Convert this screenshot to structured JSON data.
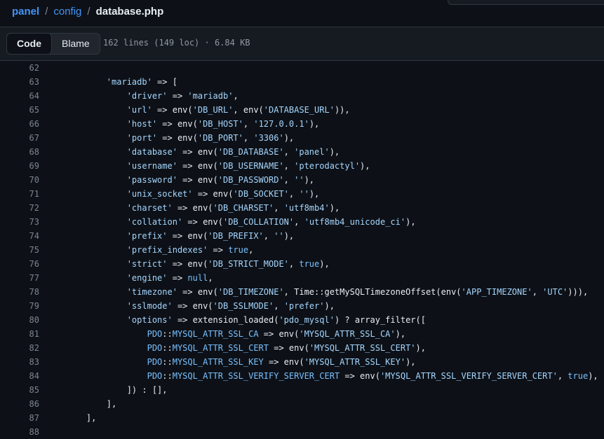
{
  "breadcrumb": {
    "repo": "panel",
    "folder": "config",
    "file": "database.php",
    "separator": "/"
  },
  "toolbar": {
    "code_label": "Code",
    "blame_label": "Blame",
    "file_info": "162 lines (149 loc) · 6.84 KB"
  },
  "colors": {
    "string": "#a5d6ff",
    "constant": "#79c0ff",
    "function": "#d2a8ff",
    "link": "#4493f8",
    "background": "#0d1117"
  },
  "code_lines": [
    {
      "n": "62",
      "tokens": [
        {
          "t": "",
          "c": "p"
        }
      ]
    },
    {
      "n": "63",
      "tokens": [
        {
          "t": "        ",
          "c": "p"
        },
        {
          "t": "'mariadb'",
          "c": "s"
        },
        {
          "t": " => [",
          "c": "p"
        }
      ]
    },
    {
      "n": "64",
      "tokens": [
        {
          "t": "            ",
          "c": "p"
        },
        {
          "t": "'driver'",
          "c": "s"
        },
        {
          "t": " => ",
          "c": "p"
        },
        {
          "t": "'mariadb'",
          "c": "s"
        },
        {
          "t": ",",
          "c": "p"
        }
      ]
    },
    {
      "n": "65",
      "tokens": [
        {
          "t": "            ",
          "c": "p"
        },
        {
          "t": "'url'",
          "c": "s"
        },
        {
          "t": " => env(",
          "c": "p"
        },
        {
          "t": "'DB_URL'",
          "c": "s"
        },
        {
          "t": ", env(",
          "c": "p"
        },
        {
          "t": "'DATABASE_URL'",
          "c": "s"
        },
        {
          "t": ")),",
          "c": "p"
        }
      ]
    },
    {
      "n": "66",
      "tokens": [
        {
          "t": "            ",
          "c": "p"
        },
        {
          "t": "'host'",
          "c": "s"
        },
        {
          "t": " => env(",
          "c": "p"
        },
        {
          "t": "'DB_HOST'",
          "c": "s"
        },
        {
          "t": ", ",
          "c": "p"
        },
        {
          "t": "'127.0.0.1'",
          "c": "s"
        },
        {
          "t": "),",
          "c": "p"
        }
      ]
    },
    {
      "n": "67",
      "tokens": [
        {
          "t": "            ",
          "c": "p"
        },
        {
          "t": "'port'",
          "c": "s"
        },
        {
          "t": " => env(",
          "c": "p"
        },
        {
          "t": "'DB_PORT'",
          "c": "s"
        },
        {
          "t": ", ",
          "c": "p"
        },
        {
          "t": "'3306'",
          "c": "s"
        },
        {
          "t": "),",
          "c": "p"
        }
      ]
    },
    {
      "n": "68",
      "tokens": [
        {
          "t": "            ",
          "c": "p"
        },
        {
          "t": "'database'",
          "c": "s"
        },
        {
          "t": " => env(",
          "c": "p"
        },
        {
          "t": "'DB_DATABASE'",
          "c": "s"
        },
        {
          "t": ", ",
          "c": "p"
        },
        {
          "t": "'panel'",
          "c": "s"
        },
        {
          "t": "),",
          "c": "p"
        }
      ]
    },
    {
      "n": "69",
      "tokens": [
        {
          "t": "            ",
          "c": "p"
        },
        {
          "t": "'username'",
          "c": "s"
        },
        {
          "t": " => env(",
          "c": "p"
        },
        {
          "t": "'DB_USERNAME'",
          "c": "s"
        },
        {
          "t": ", ",
          "c": "p"
        },
        {
          "t": "'pterodactyl'",
          "c": "s"
        },
        {
          "t": "),",
          "c": "p"
        }
      ]
    },
    {
      "n": "70",
      "tokens": [
        {
          "t": "            ",
          "c": "p"
        },
        {
          "t": "'password'",
          "c": "s"
        },
        {
          "t": " => env(",
          "c": "p"
        },
        {
          "t": "'DB_PASSWORD'",
          "c": "s"
        },
        {
          "t": ", ",
          "c": "p"
        },
        {
          "t": "''",
          "c": "s"
        },
        {
          "t": "),",
          "c": "p"
        }
      ]
    },
    {
      "n": "71",
      "tokens": [
        {
          "t": "            ",
          "c": "p"
        },
        {
          "t": "'unix_socket'",
          "c": "s"
        },
        {
          "t": " => env(",
          "c": "p"
        },
        {
          "t": "'DB_SOCKET'",
          "c": "s"
        },
        {
          "t": ", ",
          "c": "p"
        },
        {
          "t": "''",
          "c": "s"
        },
        {
          "t": "),",
          "c": "p"
        }
      ]
    },
    {
      "n": "72",
      "tokens": [
        {
          "t": "            ",
          "c": "p"
        },
        {
          "t": "'charset'",
          "c": "s"
        },
        {
          "t": " => env(",
          "c": "p"
        },
        {
          "t": "'DB_CHARSET'",
          "c": "s"
        },
        {
          "t": ", ",
          "c": "p"
        },
        {
          "t": "'utf8mb4'",
          "c": "s"
        },
        {
          "t": "),",
          "c": "p"
        }
      ]
    },
    {
      "n": "73",
      "tokens": [
        {
          "t": "            ",
          "c": "p"
        },
        {
          "t": "'collation'",
          "c": "s"
        },
        {
          "t": " => env(",
          "c": "p"
        },
        {
          "t": "'DB_COLLATION'",
          "c": "s"
        },
        {
          "t": ", ",
          "c": "p"
        },
        {
          "t": "'utf8mb4_unicode_ci'",
          "c": "s"
        },
        {
          "t": "),",
          "c": "p"
        }
      ]
    },
    {
      "n": "74",
      "tokens": [
        {
          "t": "            ",
          "c": "p"
        },
        {
          "t": "'prefix'",
          "c": "s"
        },
        {
          "t": " => env(",
          "c": "p"
        },
        {
          "t": "'DB_PREFIX'",
          "c": "s"
        },
        {
          "t": ", ",
          "c": "p"
        },
        {
          "t": "''",
          "c": "s"
        },
        {
          "t": "),",
          "c": "p"
        }
      ]
    },
    {
      "n": "75",
      "tokens": [
        {
          "t": "            ",
          "c": "p"
        },
        {
          "t": "'prefix_indexes'",
          "c": "s"
        },
        {
          "t": " => ",
          "c": "p"
        },
        {
          "t": "true",
          "c": "k"
        },
        {
          "t": ",",
          "c": "p"
        }
      ]
    },
    {
      "n": "76",
      "tokens": [
        {
          "t": "            ",
          "c": "p"
        },
        {
          "t": "'strict'",
          "c": "s"
        },
        {
          "t": " => env(",
          "c": "p"
        },
        {
          "t": "'DB_STRICT_MODE'",
          "c": "s"
        },
        {
          "t": ", ",
          "c": "p"
        },
        {
          "t": "true",
          "c": "k"
        },
        {
          "t": "),",
          "c": "p"
        }
      ]
    },
    {
      "n": "77",
      "tokens": [
        {
          "t": "            ",
          "c": "p"
        },
        {
          "t": "'engine'",
          "c": "s"
        },
        {
          "t": " => ",
          "c": "p"
        },
        {
          "t": "null",
          "c": "k"
        },
        {
          "t": ",",
          "c": "p"
        }
      ]
    },
    {
      "n": "78",
      "tokens": [
        {
          "t": "            ",
          "c": "p"
        },
        {
          "t": "'timezone'",
          "c": "s"
        },
        {
          "t": " => env(",
          "c": "p"
        },
        {
          "t": "'DB_TIMEZONE'",
          "c": "s"
        },
        {
          "t": ", Time::getMySQLTimezoneOffset(env(",
          "c": "p"
        },
        {
          "t": "'APP_TIMEZONE'",
          "c": "s"
        },
        {
          "t": ", ",
          "c": "p"
        },
        {
          "t": "'UTC'",
          "c": "s"
        },
        {
          "t": "))),",
          "c": "p"
        }
      ]
    },
    {
      "n": "79",
      "tokens": [
        {
          "t": "            ",
          "c": "p"
        },
        {
          "t": "'sslmode'",
          "c": "s"
        },
        {
          "t": " => env(",
          "c": "p"
        },
        {
          "t": "'DB_SSLMODE'",
          "c": "s"
        },
        {
          "t": ", ",
          "c": "p"
        },
        {
          "t": "'prefer'",
          "c": "s"
        },
        {
          "t": "),",
          "c": "p"
        }
      ]
    },
    {
      "n": "80",
      "tokens": [
        {
          "t": "            ",
          "c": "p"
        },
        {
          "t": "'options'",
          "c": "s"
        },
        {
          "t": " => extension_loaded(",
          "c": "p"
        },
        {
          "t": "'pdo_mysql'",
          "c": "s"
        },
        {
          "t": ") ? array_filter([",
          "c": "p"
        }
      ]
    },
    {
      "n": "81",
      "tokens": [
        {
          "t": "                ",
          "c": "p"
        },
        {
          "t": "PDO",
          "c": "k"
        },
        {
          "t": "::",
          "c": "p"
        },
        {
          "t": "MYSQL_ATTR_SSL_CA",
          "c": "k"
        },
        {
          "t": " => env(",
          "c": "p"
        },
        {
          "t": "'MYSQL_ATTR_SSL_CA'",
          "c": "s"
        },
        {
          "t": "),",
          "c": "p"
        }
      ]
    },
    {
      "n": "82",
      "tokens": [
        {
          "t": "                ",
          "c": "p"
        },
        {
          "t": "PDO",
          "c": "k"
        },
        {
          "t": "::",
          "c": "p"
        },
        {
          "t": "MYSQL_ATTR_SSL_CERT",
          "c": "k"
        },
        {
          "t": " => env(",
          "c": "p"
        },
        {
          "t": "'MYSQL_ATTR_SSL_CERT'",
          "c": "s"
        },
        {
          "t": "),",
          "c": "p"
        }
      ]
    },
    {
      "n": "83",
      "tokens": [
        {
          "t": "                ",
          "c": "p"
        },
        {
          "t": "PDO",
          "c": "k"
        },
        {
          "t": "::",
          "c": "p"
        },
        {
          "t": "MYSQL_ATTR_SSL_KEY",
          "c": "k"
        },
        {
          "t": " => env(",
          "c": "p"
        },
        {
          "t": "'MYSQL_ATTR_SSL_KEY'",
          "c": "s"
        },
        {
          "t": "),",
          "c": "p"
        }
      ]
    },
    {
      "n": "84",
      "tokens": [
        {
          "t": "                ",
          "c": "p"
        },
        {
          "t": "PDO",
          "c": "k"
        },
        {
          "t": "::",
          "c": "p"
        },
        {
          "t": "MYSQL_ATTR_SSL_VERIFY_SERVER_CERT",
          "c": "k"
        },
        {
          "t": " => env(",
          "c": "p"
        },
        {
          "t": "'MYSQL_ATTR_SSL_VERIFY_SERVER_CERT'",
          "c": "s"
        },
        {
          "t": ", ",
          "c": "p"
        },
        {
          "t": "true",
          "c": "k"
        },
        {
          "t": "),",
          "c": "p"
        }
      ]
    },
    {
      "n": "85",
      "tokens": [
        {
          "t": "            ]) : [],",
          "c": "p"
        }
      ]
    },
    {
      "n": "86",
      "tokens": [
        {
          "t": "        ],",
          "c": "p"
        }
      ]
    },
    {
      "n": "87",
      "tokens": [
        {
          "t": "    ],",
          "c": "p"
        }
      ]
    },
    {
      "n": "88",
      "tokens": [
        {
          "t": "",
          "c": "p"
        }
      ]
    }
  ]
}
